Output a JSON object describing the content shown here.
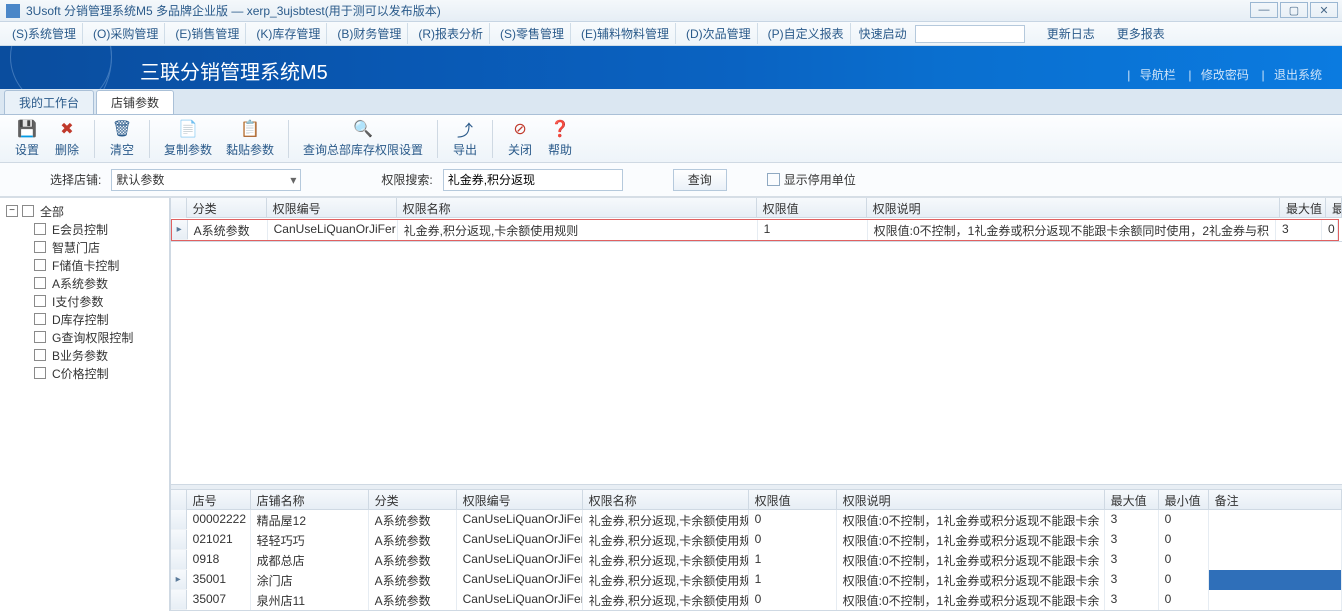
{
  "window": {
    "title": "3Usoft 分销管理系统M5 多品牌企业版 — xerp_3ujsbtest(用于测可以发布版本)"
  },
  "menu": {
    "items": [
      "(S)系统管理",
      "(O)采购管理",
      "(E)销售管理",
      "(K)库存管理",
      "(B)财务管理",
      "(R)报表分析",
      "(S)零售管理",
      "(E)辅料物料管理",
      "(D)次品管理",
      "(P)自定义报表"
    ],
    "quick_label": "快速启动",
    "link_update": "更新日志",
    "link_more": "更多报表"
  },
  "banner": {
    "title": "三联分销管理系统M5",
    "links": {
      "nav": "导航栏",
      "pwd": "修改密码",
      "exit": "退出系统"
    }
  },
  "tabs": {
    "t1": "我的工作台",
    "t2": "店铺参数"
  },
  "toolbar": {
    "set": "设置",
    "del": "删除",
    "clear": "清空",
    "copy": "复制参数",
    "paste": "黏贴参数",
    "queryhq": "查询总部库存权限设置",
    "export": "导出",
    "close": "关闭",
    "help": "帮助"
  },
  "filter": {
    "shop_label": "选择店铺:",
    "shop_value": "默认参数",
    "search_label": "权限搜索:",
    "search_value": "礼金券,积分返现",
    "query_btn": "查询",
    "show_disabled": "显示停用单位"
  },
  "tree": {
    "root": "全部",
    "items": [
      "E会员控制",
      "智慧门店",
      "F储值卡控制",
      "A系统参数",
      "I支付参数",
      "D库存控制",
      "G查询权限控制",
      "B业务参数",
      "C价格控制"
    ]
  },
  "grid1": {
    "headers": {
      "cat": "分类",
      "code": "权限编号",
      "name": "权限名称",
      "val": "权限值",
      "desc": "权限说明",
      "max": "最大值",
      "min": "最"
    },
    "row": {
      "cat": "A系统参数",
      "code": "CanUseLiQuanOrJiFer",
      "name": "礼金券,积分返现,卡余额使用规则",
      "val": "1",
      "desc": "权限值:0不控制，1礼金券或积分返现不能跟卡余额同时使用，2礼金券与积",
      "max": "3",
      "min": "0"
    }
  },
  "grid2": {
    "headers": {
      "no": "店号",
      "sname": "店铺名称",
      "cat": "分类",
      "code": "权限编号",
      "name": "权限名称",
      "val": "权限值",
      "desc": "权限说明",
      "max": "最大值",
      "min": "最小值",
      "rem": "备注"
    },
    "rows": [
      {
        "no": "00002222",
        "sname": "精品屋12",
        "cat": "A系统参数",
        "code": "CanUseLiQuanOrJiFer",
        "name": "礼金券,积分返现,卡余额使用规",
        "val": "0",
        "desc": "权限值:0不控制，1礼金券或积分返现不能跟卡余",
        "max": "3",
        "min": "0",
        "rem": ""
      },
      {
        "no": "021021",
        "sname": "轻轻巧巧",
        "cat": "A系统参数",
        "code": "CanUseLiQuanOrJiFer",
        "name": "礼金券,积分返现,卡余额使用规",
        "val": "0",
        "desc": "权限值:0不控制，1礼金券或积分返现不能跟卡余",
        "max": "3",
        "min": "0",
        "rem": ""
      },
      {
        "no": "0918",
        "sname": "成都总店",
        "cat": "A系统参数",
        "code": "CanUseLiQuanOrJiFer",
        "name": "礼金券,积分返现,卡余额使用规",
        "val": "1",
        "desc": "权限值:0不控制，1礼金券或积分返现不能跟卡余",
        "max": "3",
        "min": "0",
        "rem": ""
      },
      {
        "no": "35001",
        "sname": "涂门店",
        "cat": "A系统参数",
        "code": "CanUseLiQuanOrJiFer",
        "name": "礼金券,积分返现,卡余额使用规",
        "val": "1",
        "desc": "权限值:0不控制，1礼金券或积分返现不能跟卡余",
        "max": "3",
        "min": "0",
        "rem": ""
      },
      {
        "no": "35007",
        "sname": "泉州店11",
        "cat": "A系统参数",
        "code": "CanUseLiQuanOrJiFer",
        "name": "礼金券,积分返现,卡余额使用规",
        "val": "0",
        "desc": "权限值:0不控制，1礼金券或积分返现不能跟卡余",
        "max": "3",
        "min": "0",
        "rem": ""
      }
    ]
  }
}
